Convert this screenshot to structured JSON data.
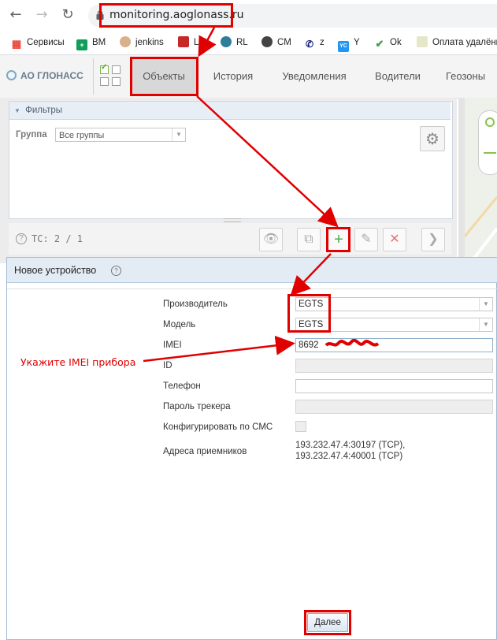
{
  "browser": {
    "url": "monitoring.aoglonass.ru",
    "bookmarks": [
      {
        "label": "Сервисы",
        "icon": "apps-grid-icon",
        "color": "#ea4335"
      },
      {
        "label": "BM",
        "icon": "green-plus-icon",
        "color": "#0f9d58"
      },
      {
        "label": "jenkins",
        "icon": "jenkins-icon",
        "color": "#d33833"
      },
      {
        "label": "LM",
        "icon": "book-icon",
        "color": "#c62828"
      },
      {
        "label": "RL",
        "icon": "globe-icon",
        "color": "#2e7d9a"
      },
      {
        "label": "CM",
        "icon": "globe-dark-icon",
        "color": "#444444"
      },
      {
        "label": "z",
        "icon": "phone-icon",
        "color": "#1a237e"
      },
      {
        "label": "Y",
        "icon": "yc-icon",
        "color": "#2196f3"
      },
      {
        "label": "Ok",
        "icon": "check-icon",
        "color": "#43a047"
      },
      {
        "label": "Оплата удалённ",
        "icon": "leaf-icon",
        "color": "#c0ca33"
      }
    ]
  },
  "app": {
    "logo": "АО ГЛОНАСС",
    "tabs": [
      "Объекты",
      "История",
      "Уведомления",
      "Водители",
      "Геозоны"
    ],
    "active_tab": "Объекты"
  },
  "filters": {
    "header": "Фильтры",
    "group_label": "Группа",
    "group_value": "Все группы"
  },
  "tc_bar": {
    "text": "ТС: 2 / 1"
  },
  "dialog": {
    "title": "Новое устройство",
    "fields": {
      "manufacturer_label": "Производитель",
      "manufacturer_value": "EGTS",
      "model_label": "Модель",
      "model_value": "EGTS",
      "imei_label": "IMEI",
      "imei_value": "8692",
      "id_label": "ID",
      "phone_label": "Телефон",
      "tracker_password_label": "Пароль трекера",
      "sms_config_label": "Конфигурировать по СМС",
      "receiver_label": "Адреса приемников",
      "receiver_lines": [
        "193.232.47.4:30197 (TCP),",
        "193.232.47.4:40001 (TCP)"
      ]
    },
    "next_button": "Далее"
  },
  "annotation": {
    "hint": "Укажите IMEI прибора",
    "color": "#e00000"
  }
}
